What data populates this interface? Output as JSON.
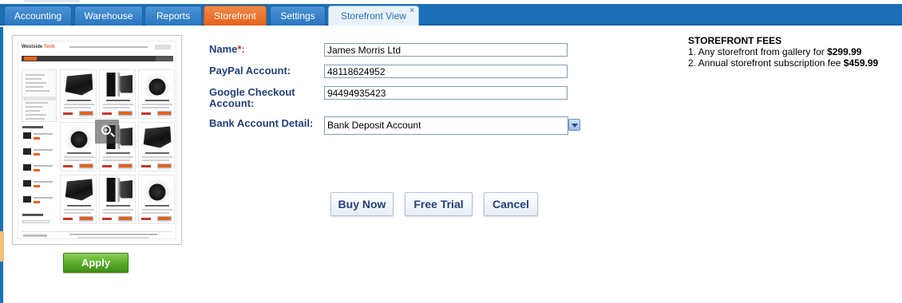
{
  "tabs": [
    {
      "label": "Accounting"
    },
    {
      "label": "Warehouse"
    },
    {
      "label": "Reports"
    },
    {
      "label": "Storefront"
    },
    {
      "label": "Settings"
    },
    {
      "label": "Storefront View",
      "close": "×"
    }
  ],
  "preview": {
    "logo_a": "Westside ",
    "logo_b": "Tech"
  },
  "apply_label": "Apply",
  "form": {
    "name_label": "Name",
    "name_required": "*:",
    "name_value": "James Morris Ltd",
    "paypal_label": "PayPal Account:",
    "paypal_value": "48118624952",
    "google_label_1": "Google Checkout",
    "google_label_2": "Account:",
    "google_value": "94494935423",
    "bank_label": "Bank Account Detail:",
    "bank_value": "Bank Deposit Account"
  },
  "buttons": {
    "buy": "Buy Now",
    "trial": "Free Trial",
    "cancel": "Cancel"
  },
  "fees": {
    "title": "STOREFRONT FEES",
    "line1_text": "1. Any storefront from gallery for ",
    "line1_price": "$299.99",
    "line2_text": "2. Annual storefront subscription fee ",
    "line2_price": "$459.99"
  }
}
